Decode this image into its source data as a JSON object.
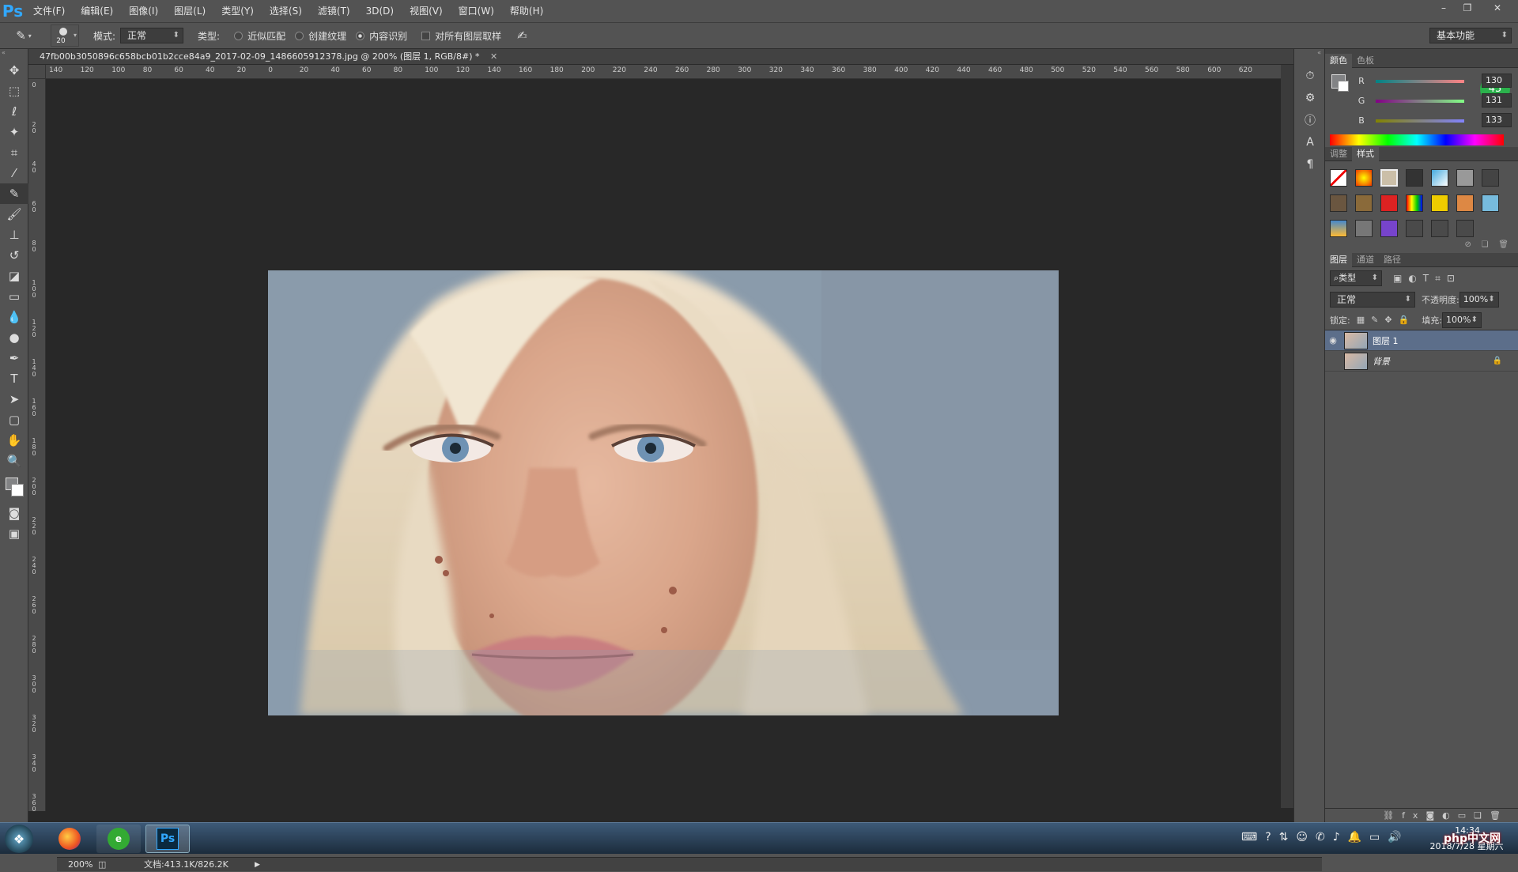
{
  "menubar": {
    "logo": "Ps",
    "items": [
      "文件(F)",
      "编辑(E)",
      "图像(I)",
      "图层(L)",
      "类型(Y)",
      "选择(S)",
      "滤镜(T)",
      "3D(D)",
      "视图(V)",
      "窗口(W)",
      "帮助(H)"
    ],
    "window_controls": [
      "–",
      "❐",
      "✕"
    ]
  },
  "options": {
    "brush_size": "20",
    "mode_label": "模式:",
    "mode_value": "正常",
    "type_label": "类型:",
    "type_options": [
      {
        "label": "近似匹配",
        "selected": false
      },
      {
        "label": "创建纹理",
        "selected": false
      },
      {
        "label": "内容识别",
        "selected": true
      }
    ],
    "sample_all_label": "对所有图层取样",
    "workspace": "基本功能"
  },
  "document": {
    "tab_title": "47fb00b3050896c658bcb01b2cce84a9_2017-02-09_1486605912378.jpg @ 200% (图层 1, RGB/8#) *",
    "ruler_h_labels": [
      "140",
      "120",
      "100",
      "80",
      "60",
      "40",
      "20",
      "0",
      "20",
      "40",
      "60",
      "80",
      "100",
      "120",
      "140",
      "160",
      "180",
      "200",
      "220",
      "240",
      "260",
      "280",
      "300",
      "320",
      "340",
      "360",
      "380",
      "400",
      "420",
      "440",
      "460",
      "480",
      "500",
      "520",
      "540",
      "560",
      "580",
      "600",
      "620"
    ],
    "ruler_v_labels": [
      "0",
      "2 0",
      "4 0",
      "6 0",
      "8 0",
      "1 0 0",
      "1 2 0",
      "1 4 0",
      "1 6 0",
      "1 8 0",
      "2 0 0",
      "2 2 0",
      "2 4 0",
      "2 6 0",
      "2 8 0",
      "3 0 0",
      "3 2 0",
      "3 4 0",
      "3 6 0"
    ]
  },
  "status": {
    "zoom": "200%",
    "doc_info": "文档:413.1K/826.2K"
  },
  "color_panel": {
    "tabs": [
      "颜色",
      "色板"
    ],
    "r_label": "R",
    "r": "130",
    "g_label": "G",
    "g": "131",
    "b_label": "B",
    "b": "133",
    "badge": "45"
  },
  "styles_panel": {
    "tabs": [
      "调整",
      "样式"
    ]
  },
  "layers_panel": {
    "tabs": [
      "图层",
      "通道",
      "路径"
    ],
    "filter_label": "类型",
    "blend_mode": "正常",
    "opacity_label": "不透明度:",
    "opacity": "100%",
    "lock_label": "锁定:",
    "fill_label": "填充:",
    "fill": "100%",
    "layers": [
      {
        "name": "图层 1",
        "visible": true,
        "selected": true
      },
      {
        "name": "背景",
        "visible": false,
        "selected": false
      }
    ]
  },
  "taskbar": {
    "time": "14:34",
    "date": "2018/7/28 星期六",
    "watermark": "php中文网"
  },
  "colors": {
    "ui_bg": "#535353",
    "canvas_bg": "#282828",
    "selected_layer": "#5c6e8a",
    "ps_blue": "#31a8ff"
  }
}
